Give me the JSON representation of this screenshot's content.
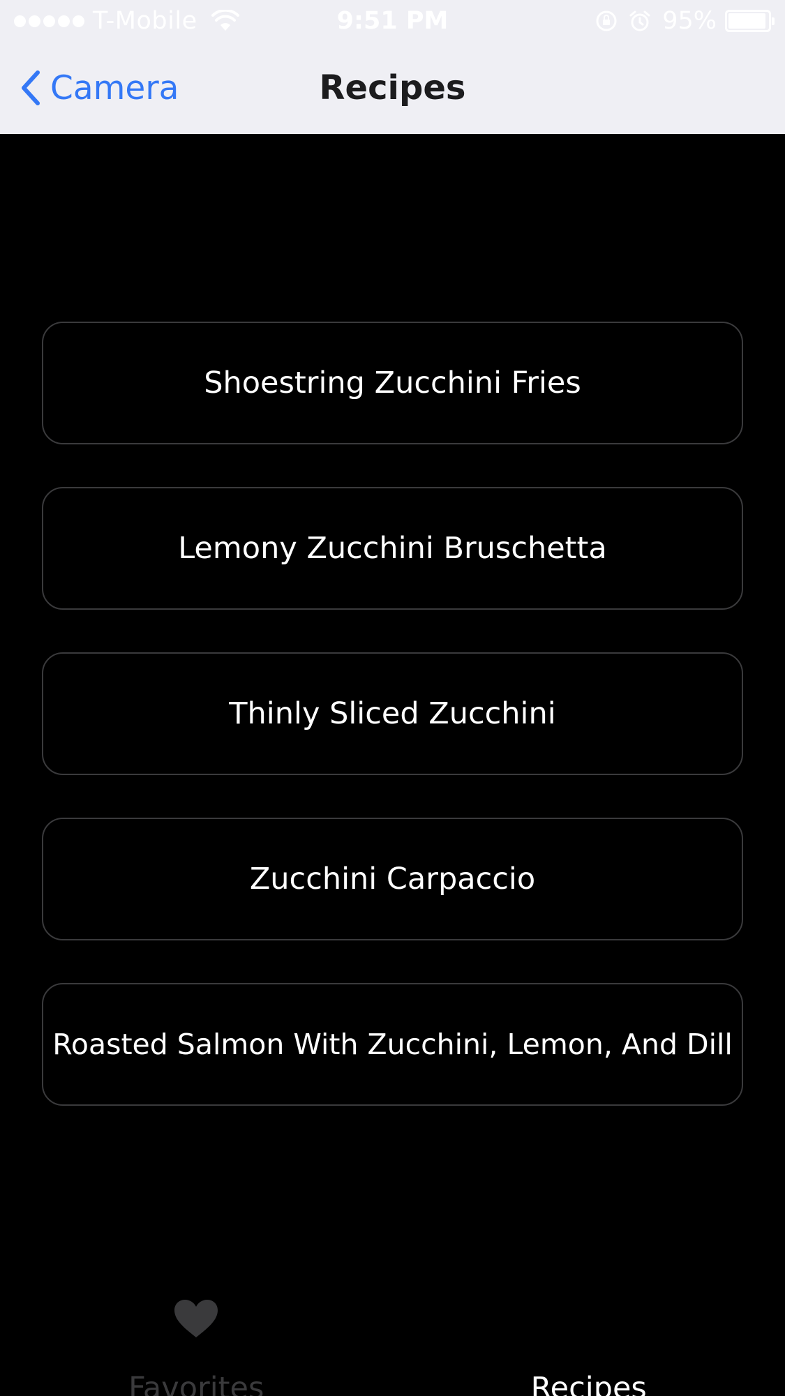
{
  "status_bar": {
    "carrier": "T-Mobile",
    "time": "9:51 PM",
    "battery_percent": "95%",
    "battery_level": 0.95,
    "icons": [
      "signal-dots-icon",
      "wifi-icon",
      "rotation-lock-icon",
      "alarm-icon",
      "battery-icon"
    ]
  },
  "nav": {
    "back_label": "Camera",
    "title": "Recipes"
  },
  "recipes": [
    "Shoestring Zucchini Fries",
    "Lemony Zucchini Bruschetta",
    "Thinly Sliced Zucchini",
    "Zucchini Carpaccio",
    "Roasted Salmon With Zucchini, Lemon, And Dill"
  ],
  "tabs": [
    {
      "label": "Favorites",
      "icon": "heart-icon",
      "selected": false
    },
    {
      "label": "Recipes",
      "icon": "",
      "selected": true
    }
  ],
  "colors": {
    "accent": "#3478f6",
    "background": "#000000",
    "bar_background": "#efeff4",
    "button_border": "#3a3a3c",
    "inactive_tab": "#3a3a3c"
  }
}
